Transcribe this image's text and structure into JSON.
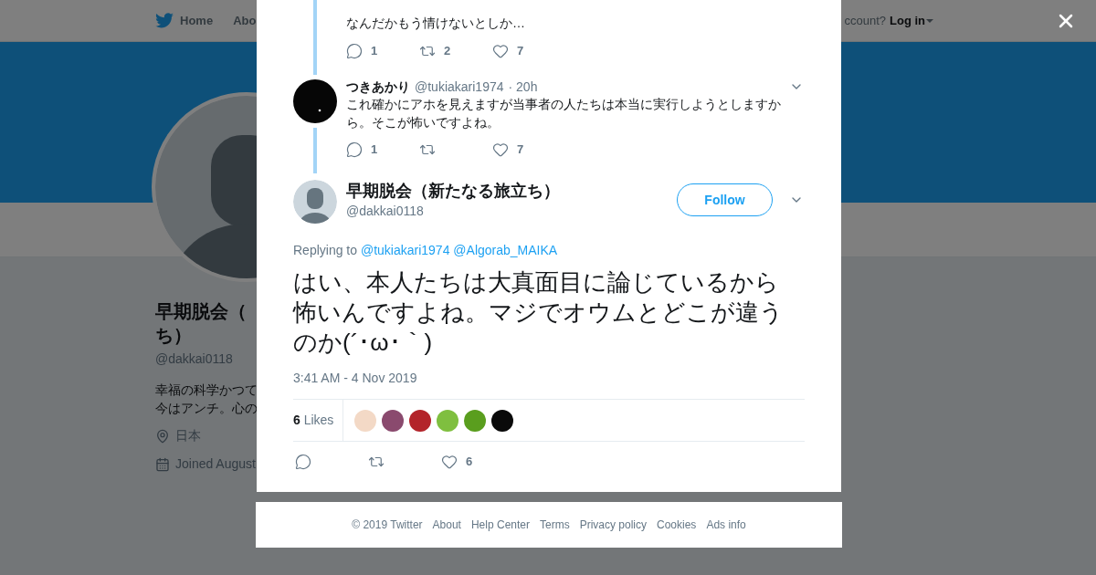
{
  "background_page": {
    "nav": {
      "items": [
        "Home",
        "Abo"
      ],
      "account_prompt": "ccount?",
      "login": "Log in"
    },
    "profile": {
      "name_line_1": "早期脱会（",
      "name_line_2": "ち）",
      "handle": "@dakkai0118",
      "bio_line_1": "幸福の科学かつて",
      "bio_line_2": "今はアンチ。心の",
      "location": "日本",
      "joined": "Joined August"
    }
  },
  "thread": [
    {
      "kind": "partial",
      "text": "なんだかもう情けないとしか…",
      "reply_count": "1",
      "retweet_count": "2",
      "like_count": "7"
    },
    {
      "kind": "reply",
      "name": "つきあかり",
      "handle": "@tukiakari1974",
      "separator": "·",
      "time": "20h",
      "text": "これ確かにアホを見えますが当事者の人たちは本当に実行しようとしますから。そこが怖いですよね。",
      "reply_count": "1",
      "like_count": "7"
    }
  ],
  "main_tweet": {
    "name": "早期脱会（新たなる旅立ち）",
    "handle": "@dakkai0118",
    "follow_label": "Follow",
    "replying_prefix": "Replying to",
    "replying_to": [
      "@tukiakari1974",
      "@Algorab_MAIKA"
    ],
    "text": "はい、本人たちは大真面目に論じているから怖いんですよね。マジでオウムとどこが違うのか(´･ω･｀)",
    "timestamp": "3:41 AM - 4 Nov 2019",
    "likes_count": "6",
    "likes_label": "Likes",
    "likers": [
      {
        "color": "#f3d9c6"
      },
      {
        "color": "#8a4a6e"
      },
      {
        "color": "#b3242a"
      },
      {
        "color": "#7fbf3f"
      },
      {
        "color": "#5a9e1e"
      },
      {
        "color": "#0a0a0a"
      }
    ],
    "like_count": "6"
  },
  "footer": [
    "© 2019 Twitter",
    "About",
    "Help Center",
    "Terms",
    "Privacy policy",
    "Cookies",
    "Ads info"
  ]
}
